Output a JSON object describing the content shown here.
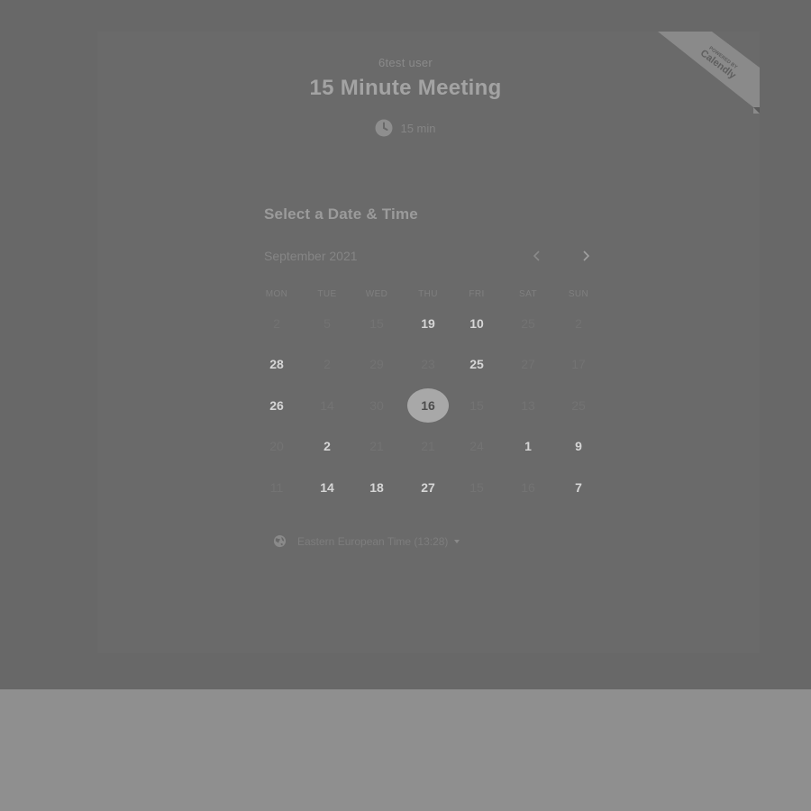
{
  "badge": {
    "powered_by": "POWERED BY",
    "brand": "Calendly"
  },
  "event": {
    "host": "6test user",
    "title": "15 Minute Meeting",
    "duration": "15 min",
    "icon": "clock-icon"
  },
  "calendar": {
    "heading": "Select a Date & Time",
    "month": "September 2021",
    "prev_icon": "chevron-left-icon",
    "next_icon": "chevron-right-icon",
    "weekdays": [
      "MON",
      "TUE",
      "WED",
      "THU",
      "FRI",
      "SAT",
      "SUN"
    ],
    "weeks": [
      [
        {
          "d": "2",
          "available": false
        },
        {
          "d": "5",
          "available": false
        },
        {
          "d": "15",
          "available": false
        },
        {
          "d": "19",
          "available": true
        },
        {
          "d": "10",
          "available": true
        },
        {
          "d": "25",
          "available": false
        },
        {
          "d": "2",
          "available": false
        }
      ],
      [
        {
          "d": "28",
          "available": true
        },
        {
          "d": "2",
          "available": false
        },
        {
          "d": "29",
          "available": false
        },
        {
          "d": "23",
          "available": false
        },
        {
          "d": "25",
          "available": true
        },
        {
          "d": "27",
          "available": false
        },
        {
          "d": "17",
          "available": false
        }
      ],
      [
        {
          "d": "26",
          "available": true
        },
        {
          "d": "14",
          "available": false
        },
        {
          "d": "30",
          "available": false
        },
        {
          "d": "16",
          "available": true,
          "selected": true
        },
        {
          "d": "15",
          "available": false
        },
        {
          "d": "13",
          "available": false
        },
        {
          "d": "25",
          "available": false
        }
      ],
      [
        {
          "d": "20",
          "available": false
        },
        {
          "d": "2",
          "available": true
        },
        {
          "d": "21",
          "available": false
        },
        {
          "d": "21",
          "available": false
        },
        {
          "d": "24",
          "available": false
        },
        {
          "d": "1",
          "available": true
        },
        {
          "d": "9",
          "available": true
        }
      ],
      [
        {
          "d": "11",
          "available": false
        },
        {
          "d": "14",
          "available": true
        },
        {
          "d": "18",
          "available": true
        },
        {
          "d": "27",
          "available": true
        },
        {
          "d": "15",
          "available": false
        },
        {
          "d": "16",
          "available": false
        },
        {
          "d": "7",
          "available": true
        }
      ]
    ]
  },
  "timezone": {
    "label": "Eastern European Time (13:28)",
    "icon": "globe-icon"
  },
  "colors": {
    "overlay": "#686868",
    "selected_day": "#a8a8a8",
    "available_day": "#d6d6d6"
  }
}
